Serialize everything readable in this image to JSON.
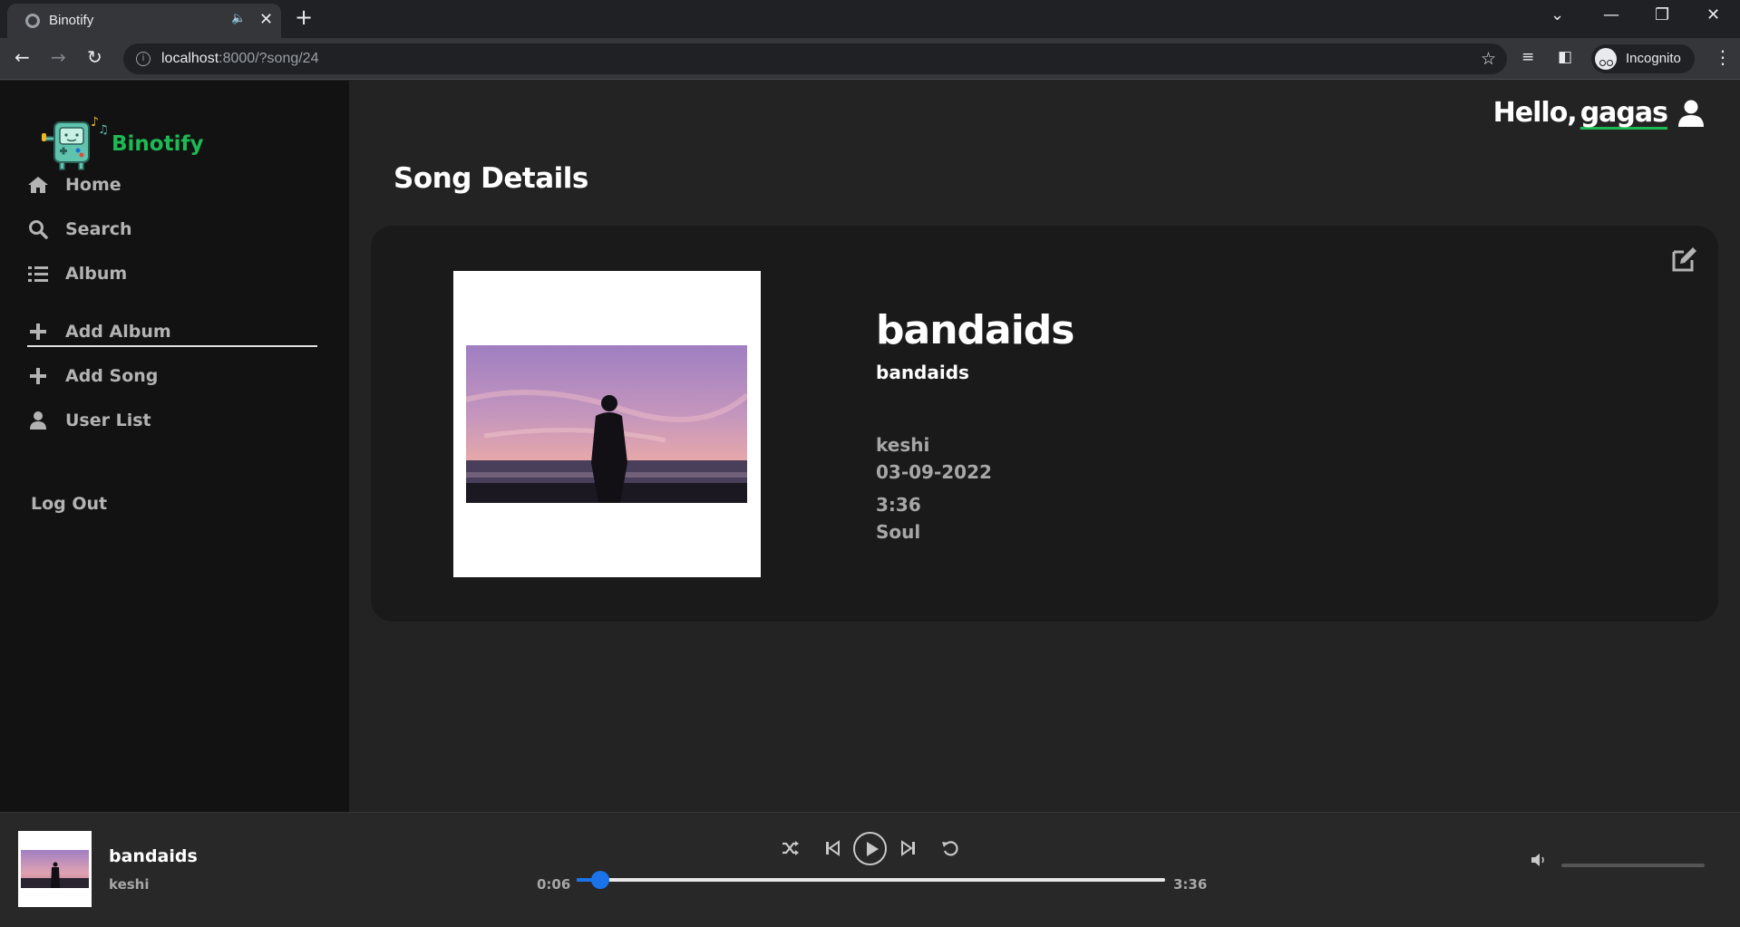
{
  "browser": {
    "tab_title": "Binotify",
    "url_host": "localhost",
    "url_path": ":8000/?song/24",
    "profile_label": "Incognito"
  },
  "sidebar": {
    "brand": "Binotify",
    "nav": [
      {
        "label": "Home",
        "icon": "home-icon"
      },
      {
        "label": "Search",
        "icon": "search-icon"
      },
      {
        "label": "Album",
        "icon": "list-icon"
      }
    ],
    "actions": [
      {
        "label": "Add Album",
        "icon": "plus-icon"
      },
      {
        "label": "Add Song",
        "icon": "plus-icon"
      },
      {
        "label": "User List",
        "icon": "user-icon"
      }
    ],
    "logout": "Log Out"
  },
  "header": {
    "greeting": "Hello,",
    "username": "gagas"
  },
  "main": {
    "page_title": "Song Details",
    "song": {
      "title": "bandaids",
      "album": "bandaids",
      "artist": "keshi",
      "release_date": "03-09-2022",
      "duration": "3:36",
      "genre": "Soul"
    }
  },
  "player": {
    "title": "bandaids",
    "artist": "keshi",
    "current_time": "0:06",
    "total_time": "3:36",
    "progress": 0.04
  },
  "colors": {
    "accent": "#1db954",
    "progress": "#1a73e8",
    "sidebar_bg": "#121212",
    "card_bg": "#1a1a1a"
  }
}
